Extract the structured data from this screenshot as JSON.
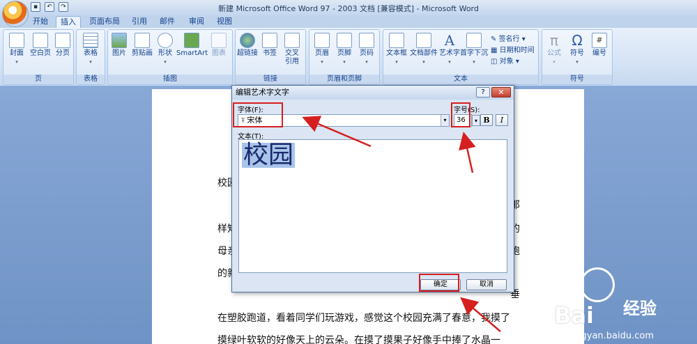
{
  "window": {
    "title": "新建 Microsoft Office Word 97 - 2003 文档 [兼容模式] - Microsoft Word"
  },
  "tabs": [
    {
      "label": "开始"
    },
    {
      "label": "插入"
    },
    {
      "label": "页面布局"
    },
    {
      "label": "引用"
    },
    {
      "label": "邮件"
    },
    {
      "label": "审阅"
    },
    {
      "label": "视图"
    }
  ],
  "ribbon": {
    "groups": {
      "page": "页",
      "table": "表格",
      "illustrations": "插图",
      "links": "链接",
      "header_footer": "页眉和页脚",
      "text": "文本",
      "symbols": "符号"
    },
    "buttons": {
      "cover": "封面",
      "blank_page": "空白页",
      "page_break": "分页",
      "table": "表格",
      "picture": "图片",
      "clipart": "剪贴画",
      "shapes": "形状",
      "smartart": "SmartArt",
      "chart": "图表",
      "hyperlink": "超链接",
      "bookmark": "书签",
      "cross_ref_line1": "交叉",
      "cross_ref_line2": "引用",
      "header": "页眉",
      "footer": "页脚",
      "page_number": "页码",
      "textbox": "文本框",
      "quick_parts": "文档部件",
      "wordart": "艺术字",
      "dropcap": "首字下沉",
      "signature": "签名行",
      "datetime": "日期和时间",
      "object": "对象",
      "equation": "公式",
      "symbol": "符号",
      "number": "编号"
    }
  },
  "document": {
    "line1_end": "；",
    "line2_start": "校园",
    "line3_end": "那",
    "line4_start": "样知",
    "line4_end": "的",
    "line5_start": "母亲",
    "line5_end": "跑",
    "line6_start": "的新",
    "line7_end": "垂",
    "line8": "在塑胶跑道，看着同学们玩游戏，感觉这个校园充满了春意，我摸了",
    "line9": "摸绿叶软软的好像天上的云朵。在摸了摸果子好像手中捧了水晶一"
  },
  "dialog": {
    "title": "编辑艺术字文字",
    "help": "?",
    "close": "✕",
    "font_label": "字体(F):",
    "font_value": "宋体",
    "size_label": "字号(S):",
    "size_value": "36",
    "bold": "B",
    "italic": "I",
    "text_label": "文本(T):",
    "text_value": "校园",
    "ok": "确定",
    "cancel": "取消"
  },
  "watermark": {
    "brand": "Bai",
    "brand2": "经验",
    "url": "jingyan.baidu.com"
  }
}
